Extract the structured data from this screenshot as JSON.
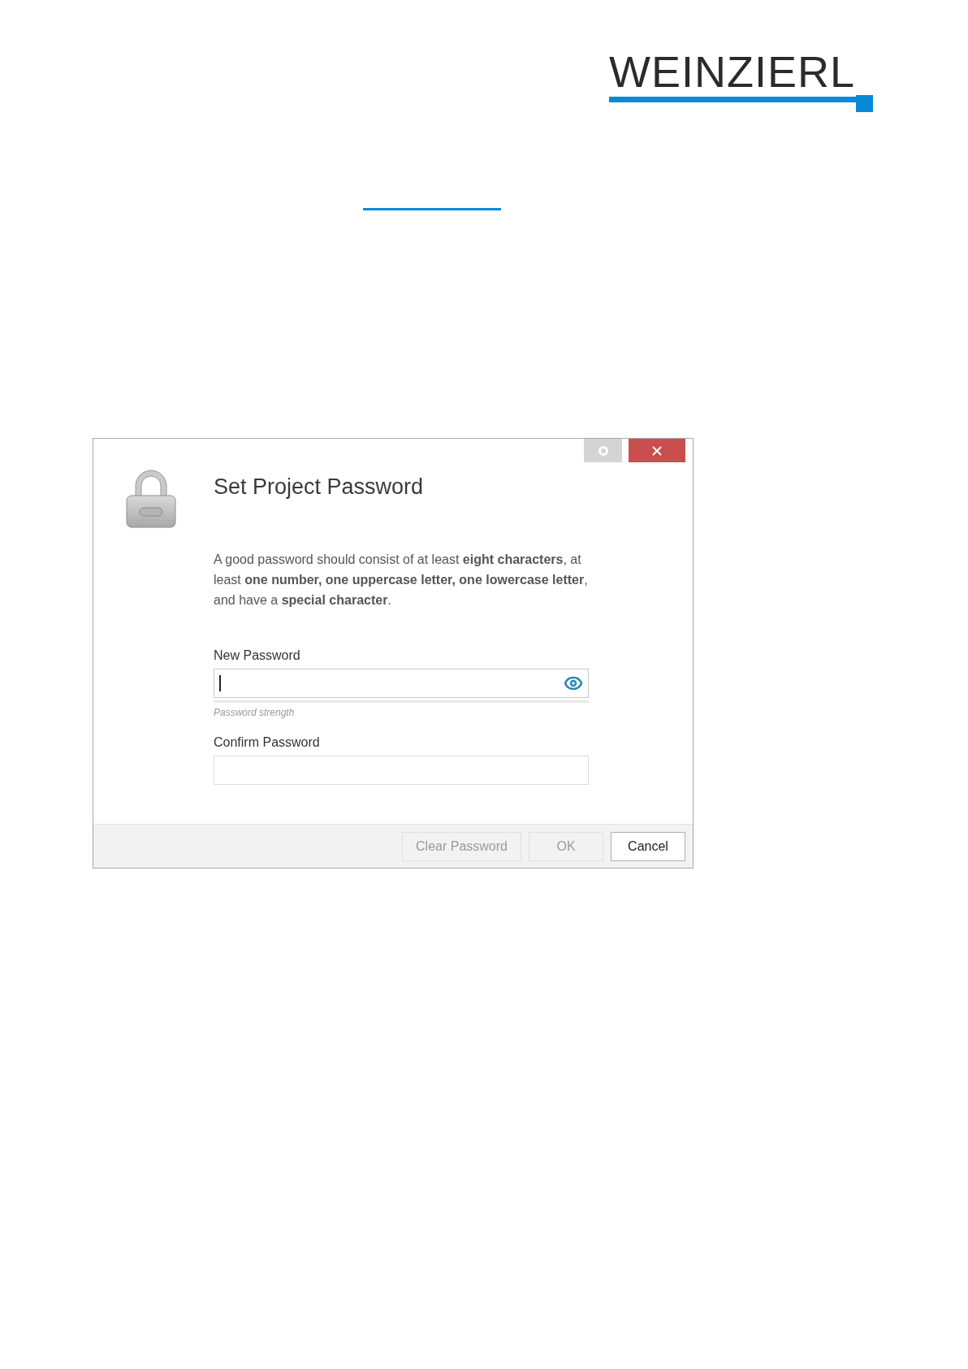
{
  "logo": {
    "text": "WEINZIERL"
  },
  "dialog": {
    "title": "Set Project Password",
    "description": "A good password should consist of at least **eight characters**, at least **one number, one uppercase letter, one lowercase letter**, and have a **special character**.",
    "fields": [
      {
        "label": "New Password",
        "focused": true,
        "reveal": true,
        "strength": {
          "level": 0,
          "label": "Password strength"
        }
      },
      {
        "label": "Confirm Password",
        "focused": false,
        "reveal": false
      }
    ],
    "buttons": [
      {
        "label": "Clear Password",
        "disabled": true
      },
      {
        "label": "OK",
        "disabled": true
      },
      {
        "label": "Cancel",
        "disabled": false
      }
    ]
  }
}
